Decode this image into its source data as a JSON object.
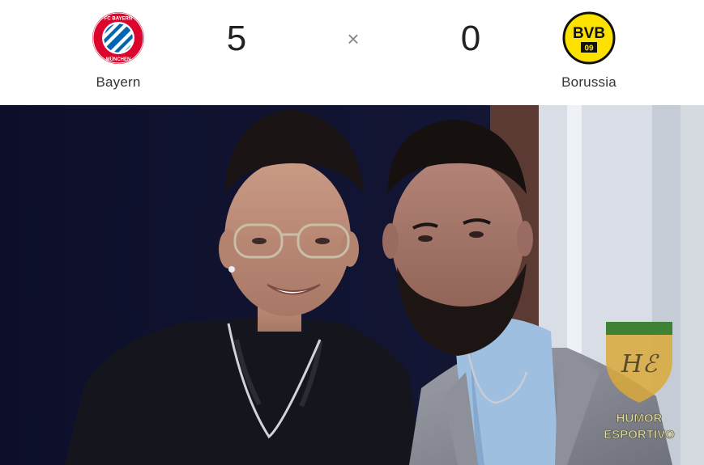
{
  "match": {
    "home_team": "Bayern",
    "away_team": "Borussia",
    "home_score": "5",
    "away_score": "0",
    "separator": "×"
  },
  "crests": {
    "home_lettering": "FC BAYERN MÜNCHEN",
    "away_lettering": "BVB 09"
  },
  "watermark": {
    "monogram": "Hℰ",
    "text_line1": "HUMOR",
    "text_line2": "ESPORTIVO"
  },
  "colors": {
    "home_red": "#dc052d",
    "home_blue": "#0066b2",
    "away_yellow": "#fde100",
    "watermark_green": "#2e7d32",
    "watermark_gold": "#d9a93a"
  }
}
